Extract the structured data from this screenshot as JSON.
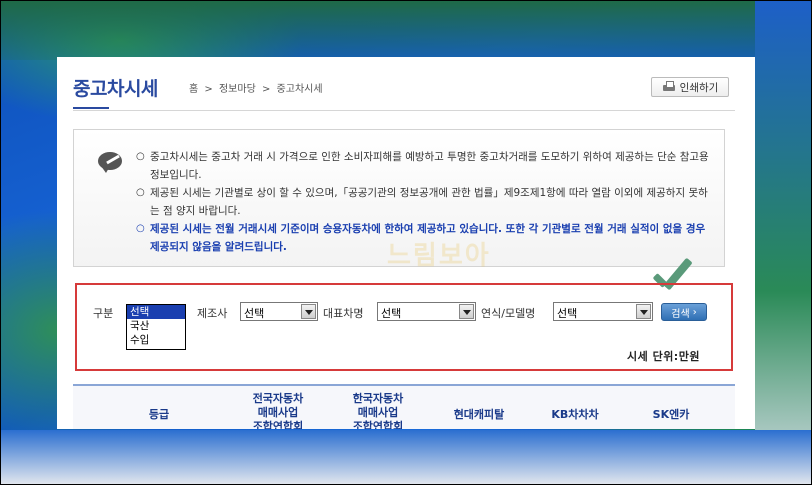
{
  "page": {
    "title": "중고차시세",
    "breadcrumb": [
      "홈",
      "정보마당",
      "중고차시세"
    ],
    "breadcrumb_sep": ">",
    "print_label": "인쇄하기"
  },
  "notice": {
    "items": [
      "중고차시세는 중고차 거래 시 가격으로 인한 소비자피해를 예방하고 투명한 중고차거래를 도모하기 위하여 제공하는 단순 참고용 정보입니다.",
      "제공된 시세는 기관별로 상이 할 수 있으며,「공공기관의 정보공개에 관한 법률」제9조제1항에 따라 열람 이외에 제공하지 못하는 점 양지 바랍니다.",
      "제공된 시세는 전월 거래시세 기준이며 승용자동차에 한하여 제공하고 있습니다. 또한 각 기관별로 전월 거래 실적이 없을 경우 제공되지 않음을 알려드립니다."
    ]
  },
  "watermark": "느림보아",
  "search": {
    "category_label": "구분",
    "category_options": [
      "선택",
      "국산",
      "수입"
    ],
    "category_selected": "선택",
    "maker_label": "제조사",
    "maker_value": "선택",
    "model_label": "대표차명",
    "model_value": "선택",
    "year_label": "연식/모델명",
    "year_value": "선택",
    "search_button": "검색",
    "search_arrow": "›"
  },
  "unit_text": "시세 단위:만원",
  "table": {
    "headers": [
      "등급",
      "전국자동차\n매매사업\n조합연합회",
      "한국자동차\n매매사업\n조합연합회",
      "현대캐피탈",
      "KB차차차",
      "SK엔카"
    ]
  },
  "colors": {
    "title_blue": "#2a4aa0",
    "notice_blue": "#1a3fb0",
    "highlight_red": "#d63a3a",
    "check_green": "#5a9a7a"
  }
}
